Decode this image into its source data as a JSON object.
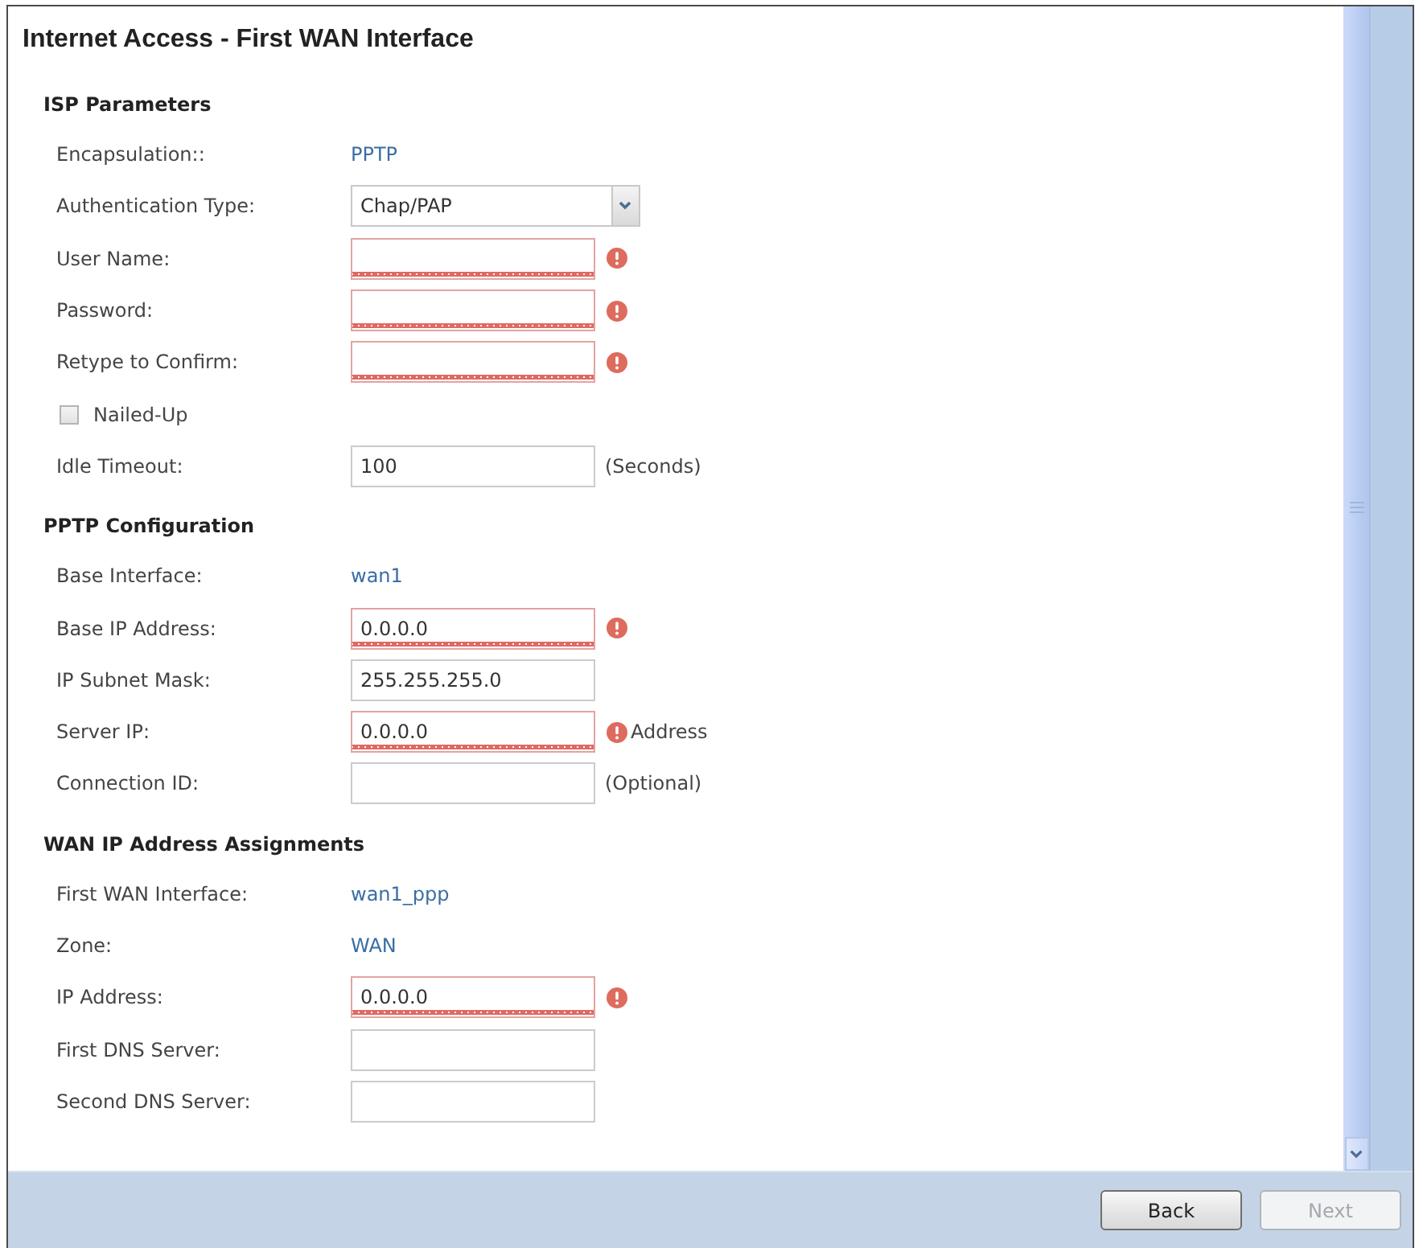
{
  "window": {
    "title": "Internet Access - First WAN Interface"
  },
  "sections": [
    {
      "heading": "ISP Parameters",
      "rows": [
        {
          "kind": "text",
          "label": "Encapsulation::",
          "value": "PPTP"
        },
        {
          "kind": "select",
          "label": "Authentication Type:",
          "value": "Chap/PAP"
        },
        {
          "kind": "input",
          "label": "User Name:",
          "invalid": true
        },
        {
          "kind": "input",
          "label": "Password:",
          "invalid": true
        },
        {
          "kind": "input",
          "label": "Retype to Confirm:",
          "invalid": true
        },
        {
          "kind": "checkbox",
          "label": "Nailed-Up",
          "checked": false
        },
        {
          "kind": "input",
          "label": "Idle Timeout:",
          "value": "100",
          "invalid": false,
          "suffix": "(Seconds)"
        }
      ]
    },
    {
      "heading": "PPTP Configuration",
      "rows": [
        {
          "kind": "text",
          "label": "Base Interface:",
          "value": "wan1"
        },
        {
          "kind": "input",
          "label": "Base IP Address:",
          "value": "0.0.0.0",
          "invalid": true
        },
        {
          "kind": "input",
          "label": "IP Subnet Mask:",
          "value": "255.255.255.0",
          "invalid": false
        },
        {
          "kind": "input",
          "label": "Server IP:",
          "value": "0.0.0.0",
          "invalid": true,
          "suffix": "Address"
        },
        {
          "kind": "input",
          "label": "Connection ID:",
          "invalid": false,
          "suffix": "(Optional)"
        }
      ]
    },
    {
      "heading": "WAN IP Address Assignments",
      "rows": [
        {
          "kind": "text",
          "label": "First WAN Interface:",
          "value": "wan1_ppp"
        },
        {
          "kind": "text",
          "label": "Zone:",
          "value": "WAN"
        },
        {
          "kind": "input",
          "label": "IP Address:",
          "value": "0.0.0.0",
          "invalid": true
        },
        {
          "kind": "input",
          "label": "First DNS Server:",
          "invalid": false
        },
        {
          "kind": "input",
          "label": "Second DNS Server:",
          "invalid": false
        }
      ]
    }
  ],
  "buttons": [
    {
      "label": "Back",
      "disabled": false
    },
    {
      "label": "Next",
      "disabled": true
    }
  ]
}
